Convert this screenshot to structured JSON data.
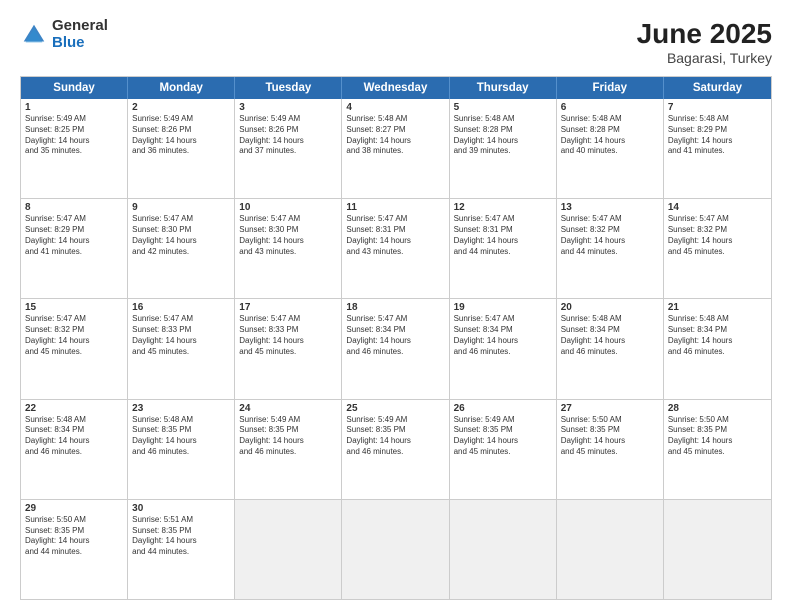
{
  "logo": {
    "general": "General",
    "blue": "Blue"
  },
  "title": {
    "month": "June 2025",
    "location": "Bagarasi, Turkey"
  },
  "header_days": [
    "Sunday",
    "Monday",
    "Tuesday",
    "Wednesday",
    "Thursday",
    "Friday",
    "Saturday"
  ],
  "rows": [
    [
      {
        "day": "1",
        "lines": [
          "Sunrise: 5:49 AM",
          "Sunset: 8:25 PM",
          "Daylight: 14 hours",
          "and 35 minutes."
        ],
        "shaded": false
      },
      {
        "day": "2",
        "lines": [
          "Sunrise: 5:49 AM",
          "Sunset: 8:26 PM",
          "Daylight: 14 hours",
          "and 36 minutes."
        ],
        "shaded": false
      },
      {
        "day": "3",
        "lines": [
          "Sunrise: 5:49 AM",
          "Sunset: 8:26 PM",
          "Daylight: 14 hours",
          "and 37 minutes."
        ],
        "shaded": false
      },
      {
        "day": "4",
        "lines": [
          "Sunrise: 5:48 AM",
          "Sunset: 8:27 PM",
          "Daylight: 14 hours",
          "and 38 minutes."
        ],
        "shaded": false
      },
      {
        "day": "5",
        "lines": [
          "Sunrise: 5:48 AM",
          "Sunset: 8:28 PM",
          "Daylight: 14 hours",
          "and 39 minutes."
        ],
        "shaded": false
      },
      {
        "day": "6",
        "lines": [
          "Sunrise: 5:48 AM",
          "Sunset: 8:28 PM",
          "Daylight: 14 hours",
          "and 40 minutes."
        ],
        "shaded": false
      },
      {
        "day": "7",
        "lines": [
          "Sunrise: 5:48 AM",
          "Sunset: 8:29 PM",
          "Daylight: 14 hours",
          "and 41 minutes."
        ],
        "shaded": false
      }
    ],
    [
      {
        "day": "8",
        "lines": [
          "Sunrise: 5:47 AM",
          "Sunset: 8:29 PM",
          "Daylight: 14 hours",
          "and 41 minutes."
        ],
        "shaded": false
      },
      {
        "day": "9",
        "lines": [
          "Sunrise: 5:47 AM",
          "Sunset: 8:30 PM",
          "Daylight: 14 hours",
          "and 42 minutes."
        ],
        "shaded": false
      },
      {
        "day": "10",
        "lines": [
          "Sunrise: 5:47 AM",
          "Sunset: 8:30 PM",
          "Daylight: 14 hours",
          "and 43 minutes."
        ],
        "shaded": false
      },
      {
        "day": "11",
        "lines": [
          "Sunrise: 5:47 AM",
          "Sunset: 8:31 PM",
          "Daylight: 14 hours",
          "and 43 minutes."
        ],
        "shaded": false
      },
      {
        "day": "12",
        "lines": [
          "Sunrise: 5:47 AM",
          "Sunset: 8:31 PM",
          "Daylight: 14 hours",
          "and 44 minutes."
        ],
        "shaded": false
      },
      {
        "day": "13",
        "lines": [
          "Sunrise: 5:47 AM",
          "Sunset: 8:32 PM",
          "Daylight: 14 hours",
          "and 44 minutes."
        ],
        "shaded": false
      },
      {
        "day": "14",
        "lines": [
          "Sunrise: 5:47 AM",
          "Sunset: 8:32 PM",
          "Daylight: 14 hours",
          "and 45 minutes."
        ],
        "shaded": false
      }
    ],
    [
      {
        "day": "15",
        "lines": [
          "Sunrise: 5:47 AM",
          "Sunset: 8:32 PM",
          "Daylight: 14 hours",
          "and 45 minutes."
        ],
        "shaded": false
      },
      {
        "day": "16",
        "lines": [
          "Sunrise: 5:47 AM",
          "Sunset: 8:33 PM",
          "Daylight: 14 hours",
          "and 45 minutes."
        ],
        "shaded": false
      },
      {
        "day": "17",
        "lines": [
          "Sunrise: 5:47 AM",
          "Sunset: 8:33 PM",
          "Daylight: 14 hours",
          "and 45 minutes."
        ],
        "shaded": false
      },
      {
        "day": "18",
        "lines": [
          "Sunrise: 5:47 AM",
          "Sunset: 8:34 PM",
          "Daylight: 14 hours",
          "and 46 minutes."
        ],
        "shaded": false
      },
      {
        "day": "19",
        "lines": [
          "Sunrise: 5:47 AM",
          "Sunset: 8:34 PM",
          "Daylight: 14 hours",
          "and 46 minutes."
        ],
        "shaded": false
      },
      {
        "day": "20",
        "lines": [
          "Sunrise: 5:48 AM",
          "Sunset: 8:34 PM",
          "Daylight: 14 hours",
          "and 46 minutes."
        ],
        "shaded": false
      },
      {
        "day": "21",
        "lines": [
          "Sunrise: 5:48 AM",
          "Sunset: 8:34 PM",
          "Daylight: 14 hours",
          "and 46 minutes."
        ],
        "shaded": false
      }
    ],
    [
      {
        "day": "22",
        "lines": [
          "Sunrise: 5:48 AM",
          "Sunset: 8:34 PM",
          "Daylight: 14 hours",
          "and 46 minutes."
        ],
        "shaded": false
      },
      {
        "day": "23",
        "lines": [
          "Sunrise: 5:48 AM",
          "Sunset: 8:35 PM",
          "Daylight: 14 hours",
          "and 46 minutes."
        ],
        "shaded": false
      },
      {
        "day": "24",
        "lines": [
          "Sunrise: 5:49 AM",
          "Sunset: 8:35 PM",
          "Daylight: 14 hours",
          "and 46 minutes."
        ],
        "shaded": false
      },
      {
        "day": "25",
        "lines": [
          "Sunrise: 5:49 AM",
          "Sunset: 8:35 PM",
          "Daylight: 14 hours",
          "and 46 minutes."
        ],
        "shaded": false
      },
      {
        "day": "26",
        "lines": [
          "Sunrise: 5:49 AM",
          "Sunset: 8:35 PM",
          "Daylight: 14 hours",
          "and 45 minutes."
        ],
        "shaded": false
      },
      {
        "day": "27",
        "lines": [
          "Sunrise: 5:50 AM",
          "Sunset: 8:35 PM",
          "Daylight: 14 hours",
          "and 45 minutes."
        ],
        "shaded": false
      },
      {
        "day": "28",
        "lines": [
          "Sunrise: 5:50 AM",
          "Sunset: 8:35 PM",
          "Daylight: 14 hours",
          "and 45 minutes."
        ],
        "shaded": false
      }
    ],
    [
      {
        "day": "29",
        "lines": [
          "Sunrise: 5:50 AM",
          "Sunset: 8:35 PM",
          "Daylight: 14 hours",
          "and 44 minutes."
        ],
        "shaded": false
      },
      {
        "day": "30",
        "lines": [
          "Sunrise: 5:51 AM",
          "Sunset: 8:35 PM",
          "Daylight: 14 hours",
          "and 44 minutes."
        ],
        "shaded": false
      },
      {
        "day": "",
        "lines": [],
        "shaded": true
      },
      {
        "day": "",
        "lines": [],
        "shaded": true
      },
      {
        "day": "",
        "lines": [],
        "shaded": true
      },
      {
        "day": "",
        "lines": [],
        "shaded": true
      },
      {
        "day": "",
        "lines": [],
        "shaded": true
      }
    ]
  ]
}
